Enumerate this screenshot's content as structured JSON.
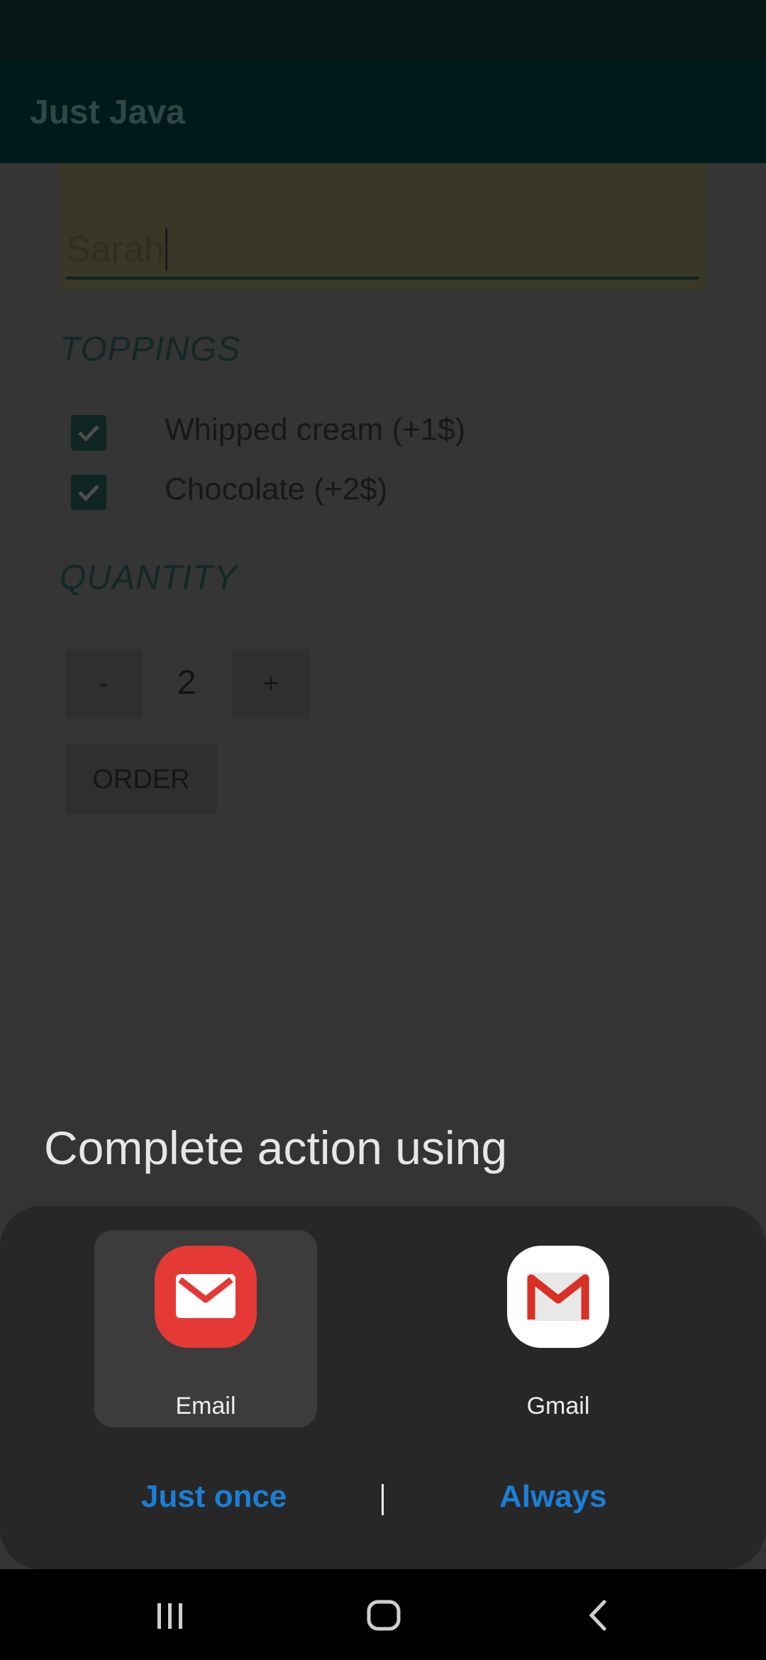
{
  "app_bar": {
    "title": "Just Java"
  },
  "form": {
    "name_value": "Sarah",
    "toppings_header": "TOPPINGS",
    "toppings": [
      {
        "label": "Whipped cream (+1$)",
        "checked": true
      },
      {
        "label": "Chocolate (+2$)",
        "checked": true
      }
    ],
    "quantity_header": "QUANTITY",
    "decrement_label": "-",
    "quantity": "2",
    "increment_label": "+",
    "order_label": "ORDER"
  },
  "dialog": {
    "title": "Complete action using",
    "apps": [
      {
        "label": "Email",
        "icon": "email-icon",
        "selected": true,
        "color": "#e53935"
      },
      {
        "label": "Gmail",
        "icon": "gmail-icon",
        "selected": false,
        "color": "#ffffff"
      }
    ],
    "just_once_label": "Just once",
    "always_label": "Always",
    "accent_color": "#1b7fd6"
  },
  "nav_bar": {
    "icons": [
      "recent-apps-icon",
      "home-icon",
      "back-icon"
    ]
  }
}
